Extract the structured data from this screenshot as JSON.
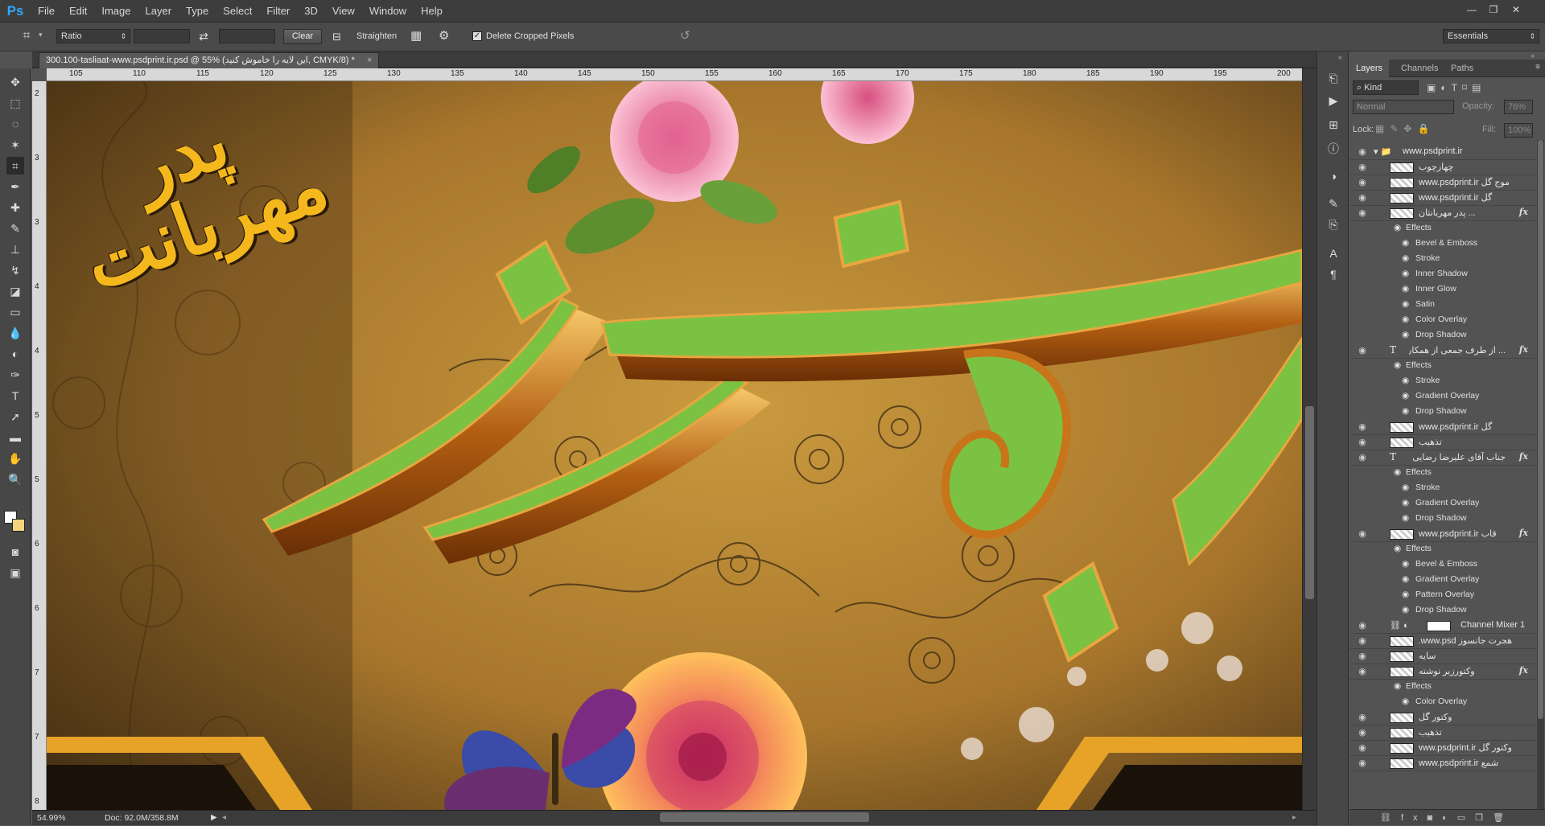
{
  "app": {
    "logo": "Ps"
  },
  "menu": [
    "File",
    "Edit",
    "Image",
    "Layer",
    "Type",
    "Select",
    "Filter",
    "3D",
    "View",
    "Window",
    "Help"
  ],
  "window_controls": [
    "—",
    "❐",
    "✕"
  ],
  "options": {
    "ratio_label": "Ratio",
    "clear_label": "Clear",
    "straighten_label": "Straighten",
    "delete_cropped_label": "Delete Cropped Pixels",
    "delete_cropped_checked": true,
    "workspace": "Essentials"
  },
  "document": {
    "tab_title": "300.100-tasliaat-www.psdprint.ir.psd @ 55% (این لایه را خاموش کنید, CMYK/8) *",
    "close": "×"
  },
  "ruler_top": [
    "105",
    "110",
    "115",
    "120",
    "125",
    "130",
    "135",
    "140",
    "145",
    "150",
    "155",
    "160",
    "165",
    "170",
    "175",
    "180",
    "185",
    "190",
    "195",
    "200"
  ],
  "ruler_left": [
    "2",
    "3",
    "3",
    "4",
    "4",
    "5",
    "5",
    "6",
    "6",
    "7",
    "7",
    "8"
  ],
  "canvas": {
    "calligraphy_text": "پدر مهربانت",
    "calligraphy_color": "#f5b81c",
    "green_color": "#7cc242",
    "gold_color": "#c8741a"
  },
  "status": {
    "zoom": "54.99%",
    "doc": "Doc: 92.0M/358.8M"
  },
  "layers_panel": {
    "tabs": [
      "Layers",
      "Channels",
      "Paths"
    ],
    "filter_kind": "Kind",
    "blend_mode": "Normal",
    "opacity_label": "Opacity:",
    "opacity_value": "76%",
    "lock_label": "Lock:",
    "fill_label": "Fill:",
    "fill_value": "100%",
    "rows": [
      {
        "type": "group",
        "name": "www.psdprint.ir"
      },
      {
        "type": "layer",
        "name": "چهارچوب"
      },
      {
        "type": "layer",
        "name": "موج گل www.psdprint.ir"
      },
      {
        "type": "layer",
        "name": "گل www.psdprint.ir"
      },
      {
        "type": "layer",
        "name": "... پدر مهربانتان",
        "fx": "fx"
      },
      {
        "type": "effects",
        "name": "Effects"
      },
      {
        "type": "effect",
        "name": "Bevel & Emboss"
      },
      {
        "type": "effect",
        "name": "Stroke"
      },
      {
        "type": "effect",
        "name": "Inner Shadow"
      },
      {
        "type": "effect",
        "name": "Inner Glow"
      },
      {
        "type": "effect",
        "name": "Satin"
      },
      {
        "type": "effect",
        "name": "Color Overlay"
      },
      {
        "type": "effect",
        "name": "Drop Shadow"
      },
      {
        "type": "text",
        "name": "... از طرف جمعی از همکاران",
        "fx": "fx"
      },
      {
        "type": "effects",
        "name": "Effects"
      },
      {
        "type": "effect",
        "name": "Stroke"
      },
      {
        "type": "effect",
        "name": "Gradient Overlay"
      },
      {
        "type": "effect",
        "name": "Drop Shadow"
      },
      {
        "type": "layer",
        "name": "گل www.psdprint.ir"
      },
      {
        "type": "layer",
        "name": "تذهیب"
      },
      {
        "type": "text",
        "name": "جناب آقای علیرضا رضایی",
        "fx": "fx"
      },
      {
        "type": "effects",
        "name": "Effects"
      },
      {
        "type": "effect",
        "name": "Stroke"
      },
      {
        "type": "effect",
        "name": "Gradient Overlay"
      },
      {
        "type": "effect",
        "name": "Drop Shadow"
      },
      {
        "type": "layer",
        "name": "قاب www.psdprint.ir",
        "fx": "fx"
      },
      {
        "type": "effects",
        "name": "Effects"
      },
      {
        "type": "effect",
        "name": "Bevel & Emboss"
      },
      {
        "type": "effect",
        "name": "Gradient Overlay"
      },
      {
        "type": "effect",
        "name": "Pattern Overlay"
      },
      {
        "type": "effect",
        "name": "Drop Shadow"
      },
      {
        "type": "adjust",
        "name": "Channel Mixer 1"
      },
      {
        "type": "layer",
        "name": "هجرت جانسوز www.psd..."
      },
      {
        "type": "layer",
        "name": "سایه"
      },
      {
        "type": "layer",
        "name": "وکتورزیر نوشته",
        "fx": "fx"
      },
      {
        "type": "effects",
        "name": "Effects"
      },
      {
        "type": "effect",
        "name": "Color Overlay"
      },
      {
        "type": "layer",
        "name": "وکتور گل"
      },
      {
        "type": "layer",
        "name": "تذهیب"
      },
      {
        "type": "layer",
        "name": "وکتور گل www.psdprint.ir"
      },
      {
        "type": "layer",
        "name": "شمع www.psdprint.ir"
      }
    ]
  }
}
